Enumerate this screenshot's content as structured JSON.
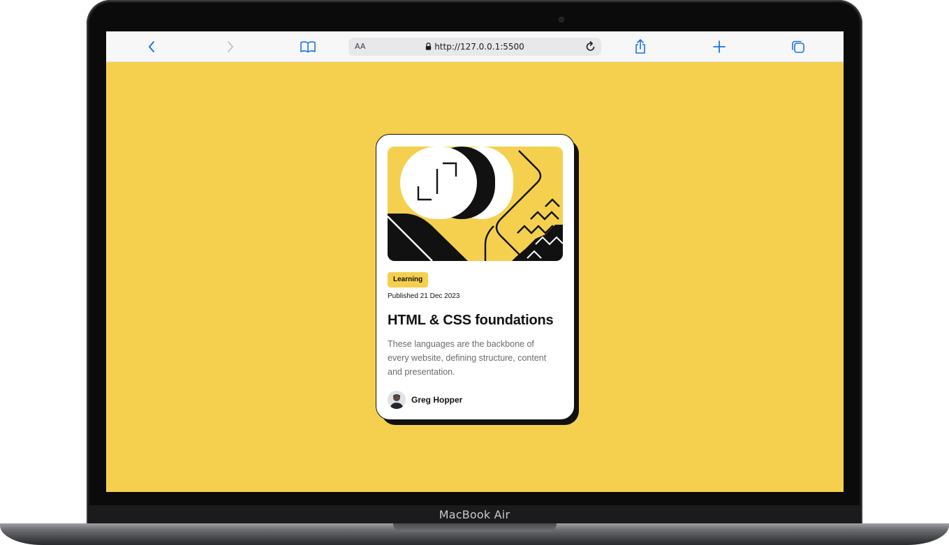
{
  "browser": {
    "text_size_label": "AA",
    "url": "http://127.0.0.1:5500"
  },
  "card": {
    "tag": "Learning",
    "published": "Published 21 Dec 2023",
    "title": "HTML & CSS foundations",
    "description": "These languages are the backbone of every website, defining structure, content and presentation.",
    "author": "Greg Hopper"
  },
  "device": {
    "model": "MacBook Air"
  },
  "colors": {
    "page_background": "#f4d04e",
    "accent": "#f4d04e",
    "text_primary": "#111111",
    "text_secondary": "#6b6b6b",
    "safari_blue": "#1a73e8"
  },
  "icons": {
    "back": "chevron-left-icon",
    "forward": "chevron-right-icon",
    "bookmarks": "book-icon",
    "lock": "lock-icon",
    "reload": "reload-icon",
    "share": "share-icon",
    "new_tab": "plus-icon",
    "tabs": "tabs-icon"
  }
}
